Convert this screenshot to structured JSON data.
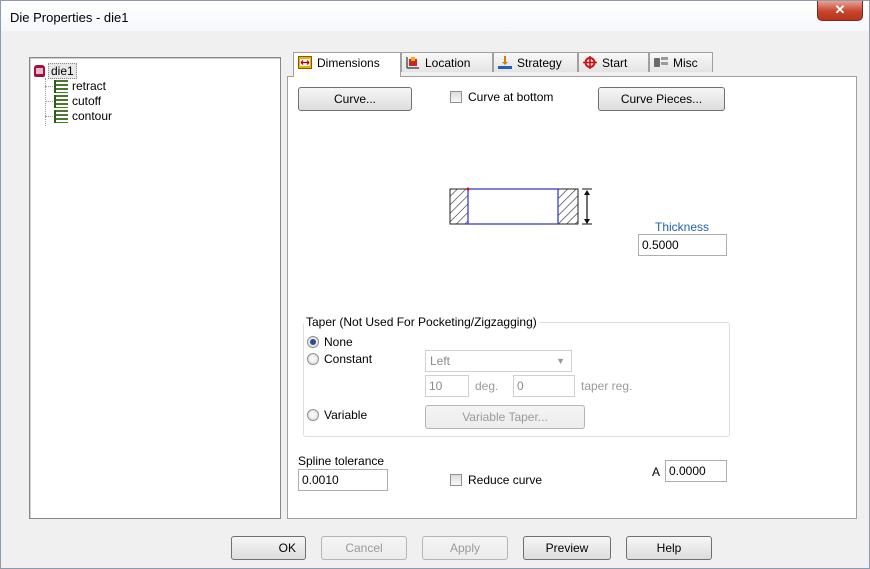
{
  "window": {
    "title": "Die Properties - die1",
    "close_glyph": "✕"
  },
  "tree": {
    "root": "die1",
    "children": [
      "retract",
      "cutoff",
      "contour"
    ]
  },
  "tabs": [
    {
      "label": "Dimensions",
      "icon": "dimensions-icon",
      "active": true
    },
    {
      "label": "Location",
      "icon": "location-icon"
    },
    {
      "label": "Strategy",
      "icon": "strategy-icon"
    },
    {
      "label": "Start",
      "icon": "start-crosshair-icon"
    },
    {
      "label": "Misc",
      "icon": "misc-icon"
    }
  ],
  "dimensions": {
    "curve_button": "Curve...",
    "curve_at_bottom_label": "Curve at bottom",
    "curve_at_bottom_checked": false,
    "curve_pieces_button": "Curve Pieces...",
    "thickness_label": "Thickness",
    "thickness_value": "0.5000",
    "taper_legend": "Taper (Not Used For Pocketing/Zigzagging)",
    "taper_none": "None",
    "taper_constant": "Constant",
    "taper_variable": "Variable",
    "taper_selected": "None",
    "direction_value": "Left",
    "angle_value": "10",
    "angle_unit": "deg.",
    "taper_reg_value": "0",
    "taper_reg_label": "taper reg.",
    "variable_taper_button": "Variable Taper...",
    "spline_tolerance_label": "Spline tolerance",
    "spline_tolerance_value": "0.0010",
    "reduce_curve_label": "Reduce curve",
    "reduce_curve_checked": false,
    "a_label": "A",
    "a_value": "0.0000"
  },
  "footer": {
    "ok": "OK",
    "cancel": "Cancel",
    "apply": "Apply",
    "preview": "Preview",
    "help": "Help"
  },
  "colors": {
    "accent_blue": "#1f5fb0",
    "close_red": "#c6452c",
    "diagram_outline": "#3b3bd0"
  }
}
